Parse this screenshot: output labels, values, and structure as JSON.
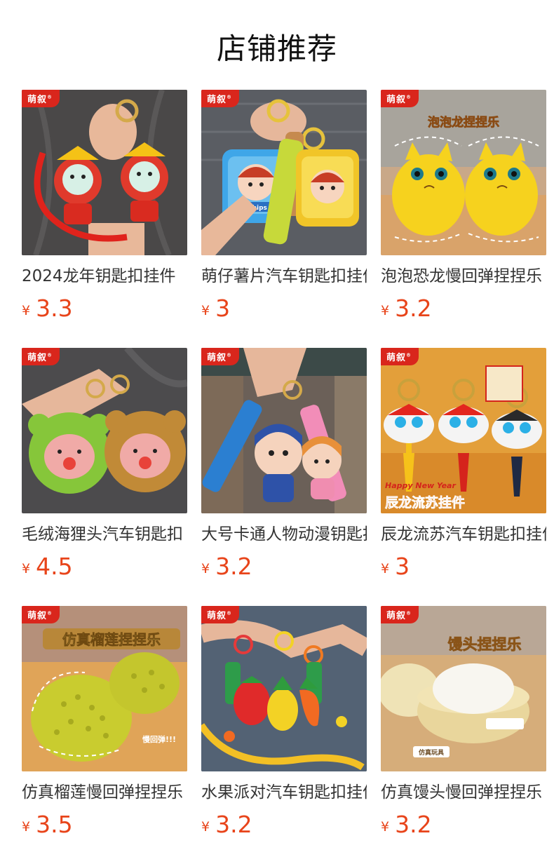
{
  "page": {
    "title": "店铺推荐"
  },
  "brand": {
    "label": "萌叙"
  },
  "currency": "¥",
  "colors": {
    "price": "#e8441a",
    "badge": "#d9261c"
  },
  "products": [
    {
      "name": "2024龙年钥匙扣挂件",
      "price": "3.3",
      "image": "dragon-keychain-photo"
    },
    {
      "name": "萌仔薯片汽车钥匙扣挂件",
      "price": "3",
      "image": "chips-keychain-photo"
    },
    {
      "name": "泡泡恐龙慢回弹捏捏乐",
      "price": "3.2",
      "image": "yellow-dino-squishy-photo",
      "overlay": "泡泡龙捏捏乐"
    },
    {
      "name": "毛绒海狸头汽车钥匙扣",
      "price": "4.5",
      "image": "plush-beaver-keychain-photo"
    },
    {
      "name": "大号卡通人物动漫钥匙扣",
      "price": "3.2",
      "image": "anime-figure-keychain-photo"
    },
    {
      "name": "辰龙流苏汽车钥匙扣挂件",
      "price": "3",
      "image": "lion-dance-tassel-keychain-photo",
      "overlay": "辰龙流苏挂件",
      "overlay2": "Happy New Year"
    },
    {
      "name": "仿真榴莲慢回弹捏捏乐",
      "price": "3.5",
      "image": "durian-squishy-photo",
      "overlay": "仿真榴莲捏捏乐",
      "overlay2": "慢回弹!!!"
    },
    {
      "name": "水果派对汽车钥匙扣挂件",
      "price": "3.2",
      "image": "fruit-keychain-photo"
    },
    {
      "name": "仿真馒头慢回弹捏捏乐",
      "price": "3.2",
      "image": "steamed-bun-squishy-photo",
      "overlay": "馒头捏捏乐",
      "overlay2": "仿真玩具"
    }
  ]
}
